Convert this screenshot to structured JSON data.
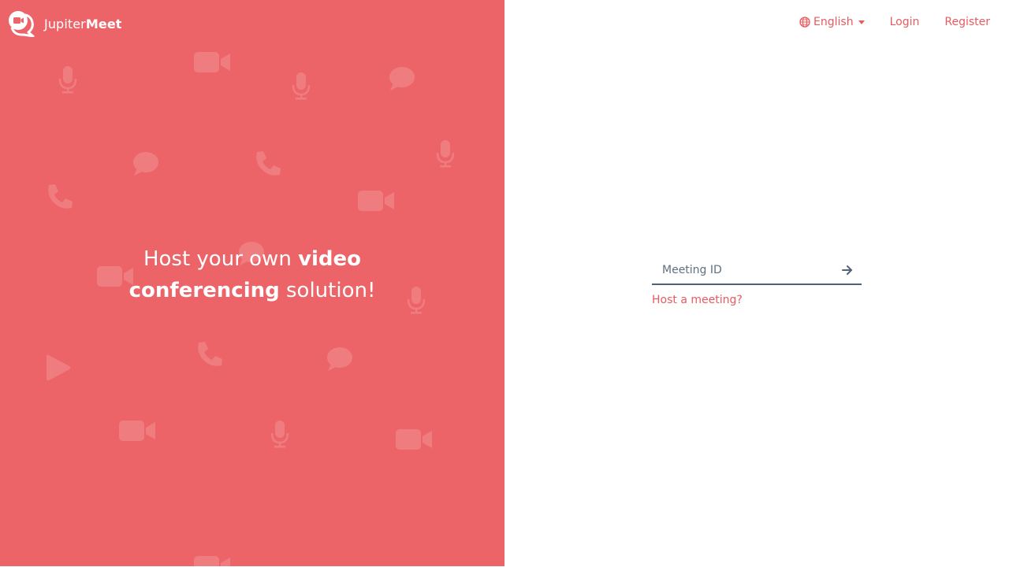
{
  "brand": {
    "name_light": "Jupiter",
    "name_bold": "Meet",
    "logo_icon": "chat-video-logo-icon"
  },
  "hero": {
    "part1": "Host your own ",
    "bold1": "video",
    "bold2": "conferencing",
    "part2": " solution!"
  },
  "nav": {
    "language": "English",
    "login": "Login",
    "register": "Register",
    "language_icon": "globe-icon"
  },
  "meeting": {
    "placeholder": "Meeting ID",
    "value": "",
    "submit_icon": "arrow-right-icon",
    "host_link": "Host a meeting?"
  },
  "colors": {
    "brand_red": "#ec6468",
    "link_red": "#e85a60",
    "input_line": "#4f6476"
  }
}
